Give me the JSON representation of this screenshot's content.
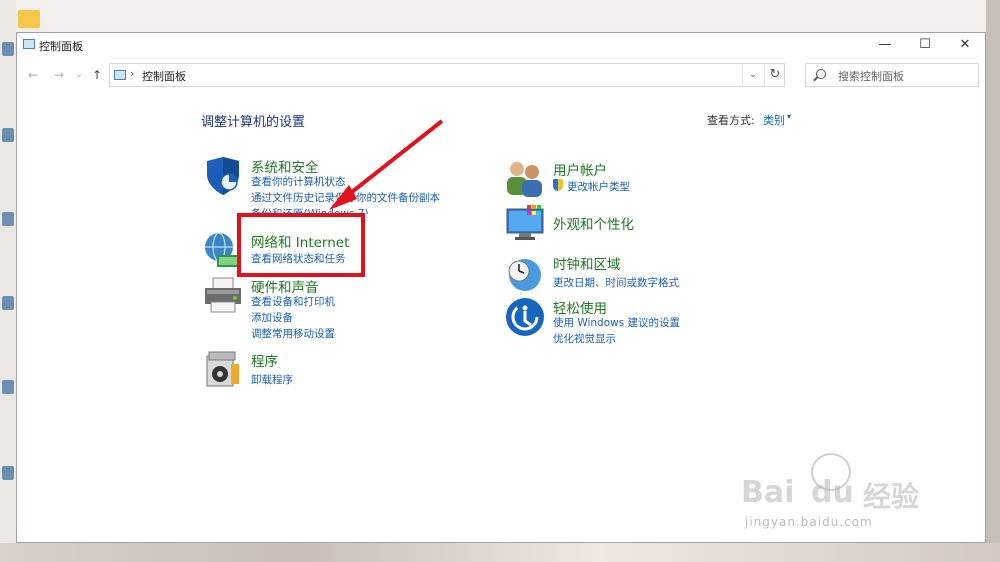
{
  "window": {
    "title": "控制面板",
    "buttons": {
      "minimize": "—",
      "maximize": "☐",
      "close": "✕"
    }
  },
  "address": {
    "back": "←",
    "forward": "→",
    "history": "⌄",
    "up": "↑",
    "separator": "›",
    "path": "控制面板",
    "dropdown": "⌄",
    "refresh": "↻"
  },
  "search": {
    "placeholder": "搜索控制面板"
  },
  "main": {
    "heading": "调整计算机的设置",
    "view_by_label": "查看方式:",
    "view_by_value": "类别",
    "view_by_arrow": "▾"
  },
  "categories_left": [
    {
      "title": "系统和安全",
      "links": [
        "查看你的计算机状态",
        "通过文件历史记录保存你的文件备份副本",
        "备份和还原(Windows 7)"
      ]
    },
    {
      "title": "网络和 Internet",
      "links": [
        "查看网络状态和任务"
      ]
    },
    {
      "title": "硬件和声音",
      "links": [
        "查看设备和打印机",
        "添加设备",
        "调整常用移动设置"
      ]
    },
    {
      "title": "程序",
      "links": [
        "卸载程序"
      ]
    }
  ],
  "categories_right": [
    {
      "title": "用户帐户",
      "links": [
        "更改帐户类型"
      ]
    },
    {
      "title": "外观和个性化",
      "links": []
    },
    {
      "title": "时钟和区域",
      "links": [
        "更改日期、时间或数字格式"
      ]
    },
    {
      "title": "轻松使用",
      "links": [
        "使用 Windows 建议的设置",
        "优化视觉显示"
      ]
    }
  ],
  "watermark": {
    "brand": "Bai",
    "brand_suffix": "du",
    "cn": "经验",
    "url": "jingyan.baidu.com"
  },
  "colors": {
    "highlight": "#e3101e",
    "category_title": "#217a21",
    "link": "#1a5fb4"
  }
}
